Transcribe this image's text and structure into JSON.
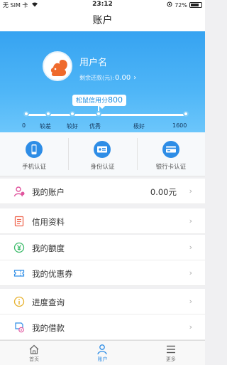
{
  "status_bar": {
    "carrier": "无 SIM 卡 ",
    "time": "23:12",
    "battery": "72%"
  },
  "nav": {
    "title": "账户"
  },
  "profile": {
    "username": "用户名",
    "balance_label": "剩余还款(元):",
    "balance_value": "0.00"
  },
  "credit": {
    "title": "松鼠信用分",
    "score": "800",
    "scale": [
      "0",
      "较差",
      "较好",
      "优秀",
      "极好",
      "1600"
    ]
  },
  "verify": [
    {
      "label": "手机认证",
      "icon": "phone-icon"
    },
    {
      "label": "身份认证",
      "icon": "id-card-icon"
    },
    {
      "label": "银行卡认证",
      "icon": "bank-card-icon"
    }
  ],
  "menu": {
    "account": {
      "label": "我的账户",
      "value": "0.00元",
      "icon": "user-icon"
    },
    "credit_info": {
      "label": "信用资料",
      "icon": "document-icon"
    },
    "quota": {
      "label": "我的额度",
      "icon": "yuan-icon"
    },
    "coupons": {
      "label": "我的优惠券",
      "icon": "coupon-icon"
    },
    "progress": {
      "label": "进度查询",
      "icon": "info-icon"
    },
    "loans": {
      "label": "我的借款",
      "icon": "loan-icon"
    }
  },
  "tabs": [
    {
      "label": "首页",
      "icon": "home-icon"
    },
    {
      "label": "账户",
      "icon": "person-icon"
    },
    {
      "label": "更多",
      "icon": "menu-icon"
    }
  ],
  "colors": {
    "accent": "#2e8de6",
    "hero_top": "#36a3f1",
    "hero_bottom": "#6cc6fb"
  }
}
